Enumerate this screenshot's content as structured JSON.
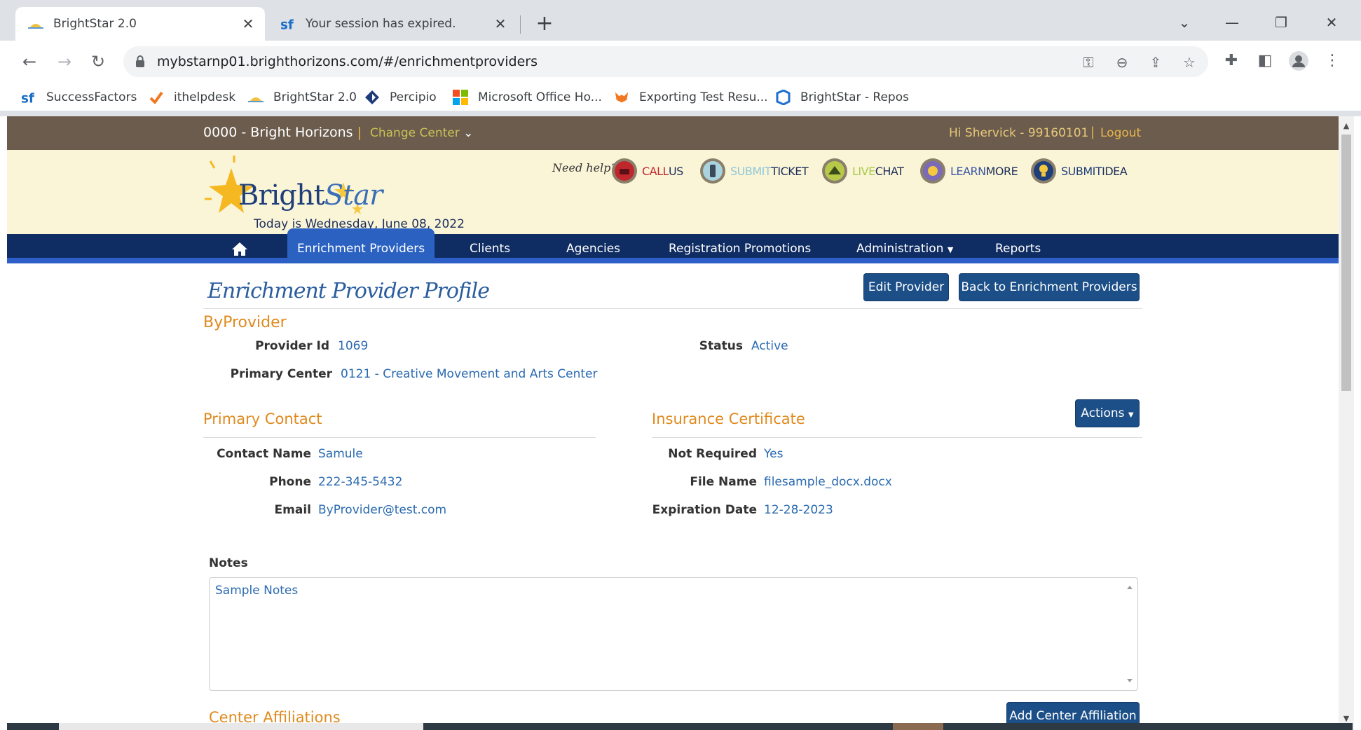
{
  "browser": {
    "tabs": [
      {
        "title": "BrightStar 2.0",
        "active": true
      },
      {
        "title": "Your session has expired.",
        "active": false
      }
    ],
    "url": "mybstarnp01.brighthorizons.com/#/enrichmentproviders",
    "bookmarks": [
      {
        "label": "SuccessFactors",
        "icon": "sf-icon"
      },
      {
        "label": "ithelpdesk",
        "icon": "check-icon"
      },
      {
        "label": "BrightStar 2.0",
        "icon": "sun-icon"
      },
      {
        "label": "Percipio",
        "icon": "percipio-icon"
      },
      {
        "label": "Microsoft Office Ho...",
        "icon": "microsoft-icon"
      },
      {
        "label": "Exporting Test Resu...",
        "icon": "fox-icon"
      },
      {
        "label": "BrightStar - Repos",
        "icon": "repos-icon"
      }
    ]
  },
  "topbar": {
    "center": "0000 - Bright Horizons",
    "separator": "|",
    "change_center": "Change Center",
    "greeting": "Hi Shervick - 99160101",
    "logout": "Logout"
  },
  "banner": {
    "logo_bright": "Bright",
    "logo_star": "Star",
    "today": "Today is Wednesday, June 08, 2022",
    "need_help": "Need help?",
    "help_links": [
      {
        "a": "CALL",
        "b": " US",
        "color_a": "#c0272d"
      },
      {
        "a": "SUBMIT",
        "b": " TICKET",
        "color_a": "#8fc7d8"
      },
      {
        "a": "LIVE",
        "b": " CHAT",
        "color_a": "#a8c94a"
      },
      {
        "a": "LEARN",
        "b": " MORE",
        "color_a": "#3d5aa8"
      },
      {
        "a": "SUBMIT",
        "b": " IDEA",
        "color_a": "#1f3f7a"
      }
    ]
  },
  "nav": {
    "items": [
      "Enrichment Providers",
      "Clients",
      "Agencies",
      "Registration Promotions",
      "Administration",
      "Reports"
    ]
  },
  "profile": {
    "title": "Enrichment Provider Profile",
    "edit_button": "Edit Provider",
    "back_button": "Back to Enrichment Providers",
    "provider_name": "ByProvider",
    "provider_id_label": "Provider Id",
    "provider_id": "1069",
    "status_label": "Status",
    "status": "Active",
    "primary_center_label": "Primary Center",
    "primary_center": "0121 - Creative Movement and Arts Center"
  },
  "primary_contact": {
    "title": "Primary Contact",
    "contact_name_label": "Contact Name",
    "contact_name": "Samule",
    "phone_label": "Phone",
    "phone": "222-345-5432",
    "email_label": "Email",
    "email": "ByProvider@test.com"
  },
  "insurance": {
    "title": "Insurance Certificate",
    "actions_button": "Actions",
    "not_required_label": "Not Required",
    "not_required": "Yes",
    "file_name_label": "File Name",
    "file_name": "filesample_docx.docx",
    "expiration_label": "Expiration Date",
    "expiration": "12-28-2023"
  },
  "notes": {
    "label": "Notes",
    "text": "Sample Notes"
  },
  "affiliations": {
    "title": "Center Affiliations",
    "add_button": "Add Center Affiliation"
  },
  "colors": {
    "topbar": "#6b5c4d",
    "banner": "#fbf5d8",
    "nav": "#0f2d63",
    "nav_active": "#2b62c2",
    "accent_orange": "#e08a1e",
    "value_blue": "#2a6ab0",
    "button_blue": "#1c4f87"
  }
}
